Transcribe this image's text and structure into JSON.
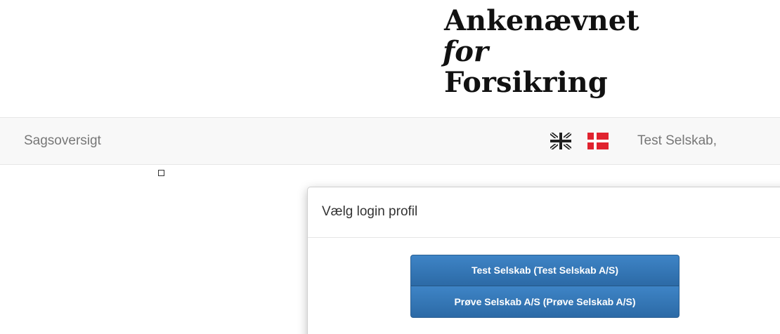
{
  "logo": {
    "line1": "Ankenævnet",
    "line2": "for",
    "line3": "Forsikring"
  },
  "navbar": {
    "brand": "Sagsoversigt",
    "languages": [
      {
        "icon": "uk-flag-icon",
        "label": "English"
      },
      {
        "icon": "denmark-flag-icon",
        "label": "Dansk"
      }
    ],
    "user": "Test Selskab,"
  },
  "modal": {
    "title": "Vælg login profil",
    "profiles": [
      "Test Selskab (Test Selskab A/S)",
      "Prøve Selskab A/S (Prøve Selskab A/S)"
    ]
  },
  "colors": {
    "navbar_bg": "#f8f8f8",
    "nav_text": "#777777",
    "button_primary": "#3278b8",
    "logo_text": "#111111"
  }
}
